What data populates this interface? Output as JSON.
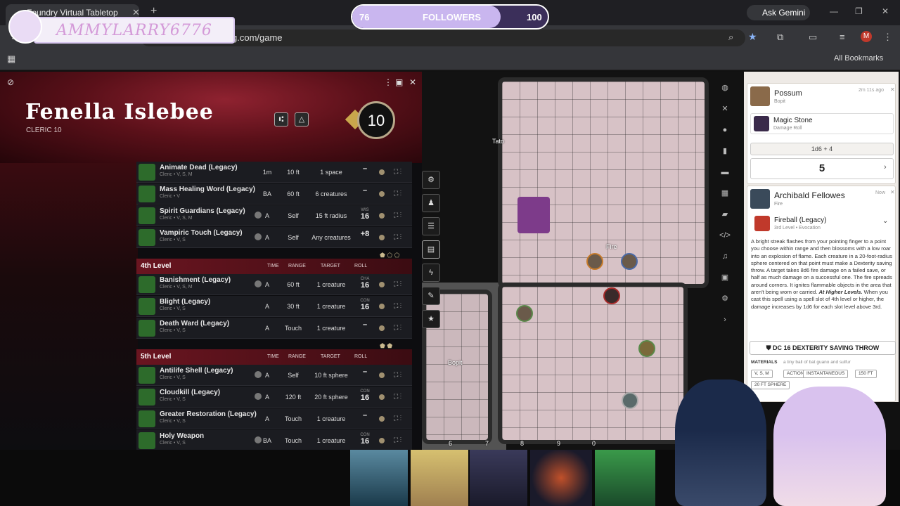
{
  "browser": {
    "tab_title": "Foundry Virtual Tabletop",
    "url": "g.com/game",
    "ask_gemini": "Ask Gemini",
    "all_bookmarks": "All Bookmarks",
    "profile_initial": "M"
  },
  "stream": {
    "followers_current": "76",
    "followers_label": "FOLLOWERS",
    "followers_goal": "100",
    "followers_progress": 0.76,
    "name_overlay": "AMMYLARRY6776"
  },
  "sheet": {
    "name": "Fenella Islebee",
    "class_level": "CLERIC 10",
    "level": "10",
    "headers": {
      "time": "TIME",
      "range": "RANGE",
      "target": "TARGET",
      "roll": "ROLL"
    },
    "spells_top": [
      {
        "name": "Animate Dead (Legacy)",
        "sub": "Cleric • V, S, M",
        "time": "1m",
        "range": "10 ft",
        "target": "1 space",
        "roll_label": "",
        "roll": "–",
        "conc": false
      },
      {
        "name": "Mass Healing Word (Legacy)",
        "sub": "Cleric • V",
        "time": "BA",
        "range": "60 ft",
        "target": "6 creatures",
        "roll_label": "",
        "roll": "–",
        "conc": false
      },
      {
        "name": "Spirit Guardians (Legacy)",
        "sub": "Cleric • V, S, M",
        "time": "A",
        "range": "Self",
        "target": "15 ft radius",
        "roll_label": "WIS",
        "roll": "16",
        "conc": true
      },
      {
        "name": "Vampiric Touch (Legacy)",
        "sub": "Cleric • V, S",
        "time": "A",
        "range": "Self",
        "target": "Any creatures",
        "roll_label": "",
        "roll": "+8",
        "conc": true
      }
    ],
    "level4": {
      "title": "4th Level",
      "spells": [
        {
          "name": "Banishment (Legacy)",
          "sub": "Cleric • V, S, M",
          "time": "A",
          "range": "60 ft",
          "target": "1 creature",
          "roll_label": "CHA",
          "roll": "16",
          "conc": true
        },
        {
          "name": "Blight (Legacy)",
          "sub": "Cleric • V, S",
          "time": "A",
          "range": "30 ft",
          "target": "1 creature",
          "roll_label": "CON",
          "roll": "16",
          "conc": false
        },
        {
          "name": "Death Ward (Legacy)",
          "sub": "Cleric • V, S",
          "time": "A",
          "range": "Touch",
          "target": "1 creature",
          "roll_label": "",
          "roll": "–",
          "conc": false
        }
      ]
    },
    "level5": {
      "title": "5th Level",
      "spells": [
        {
          "name": "Antilife Shell (Legacy)",
          "sub": "Cleric • V, S",
          "time": "A",
          "range": "Self",
          "target": "10 ft sphere",
          "roll_label": "",
          "roll": "–",
          "conc": true
        },
        {
          "name": "Cloudkill (Legacy)",
          "sub": "Cleric • V, S",
          "time": "A",
          "range": "120 ft",
          "target": "20 ft sphere",
          "roll_label": "CON",
          "roll": "16",
          "conc": true
        },
        {
          "name": "Greater Restoration (Legacy)",
          "sub": "Cleric • V, S",
          "time": "A",
          "range": "Touch",
          "target": "1 creature",
          "roll_label": "",
          "roll": "–",
          "conc": false
        },
        {
          "name": "Holy Weapon",
          "sub": "Cleric • V, S",
          "time": "BA",
          "range": "Touch",
          "target": "1 creature",
          "roll_label": "CON",
          "roll": "16",
          "conc": true
        }
      ]
    }
  },
  "map": {
    "labels": [
      "Tato",
      "Fire",
      "Bopit"
    ],
    "grid_numbers": [
      "6",
      "7",
      "8",
      "9",
      "0"
    ]
  },
  "chat": {
    "msg1": {
      "speaker": "Possum",
      "sub": "Bopit",
      "time": "2m 11s ago",
      "item": "Magic Stone",
      "item_sub": "Damage Roll",
      "formula": "1d6 + 4",
      "total": "5"
    },
    "msg2": {
      "speaker": "Archibald Fellowes",
      "sub": "Fire",
      "time": "Now",
      "spell": "Fireball (Legacy)",
      "spell_sub": "3rd Level • Evocation",
      "description": "A bright streak flashes from your pointing finger to a point you choose within range and then blossoms with a low roar into an explosion of flame. Each creature in a 20-foot-radius sphere centered on that point must make a Dexterity saving throw. A target takes 8d6 fire damage on a failed save, or half as much damage on a successful one. The fire spreads around corners. It ignites flammable objects in the area that aren't being worn or carried.",
      "higher_label": "At Higher Levels.",
      "higher_text": "When you cast this spell using a spell slot of 4th level or higher, the damage increases by 1d6 for each slot level above 3rd.",
      "save_button": "DC 16 DEXTERITY SAVING THROW",
      "materials_label": "MATERIALS",
      "materials": "a tiny ball of bat guano and sulfur",
      "tags": [
        "V, S, M",
        "ACTION",
        "INSTANTANEOUS",
        "150 FT",
        "20 FT SPHERE"
      ]
    }
  }
}
